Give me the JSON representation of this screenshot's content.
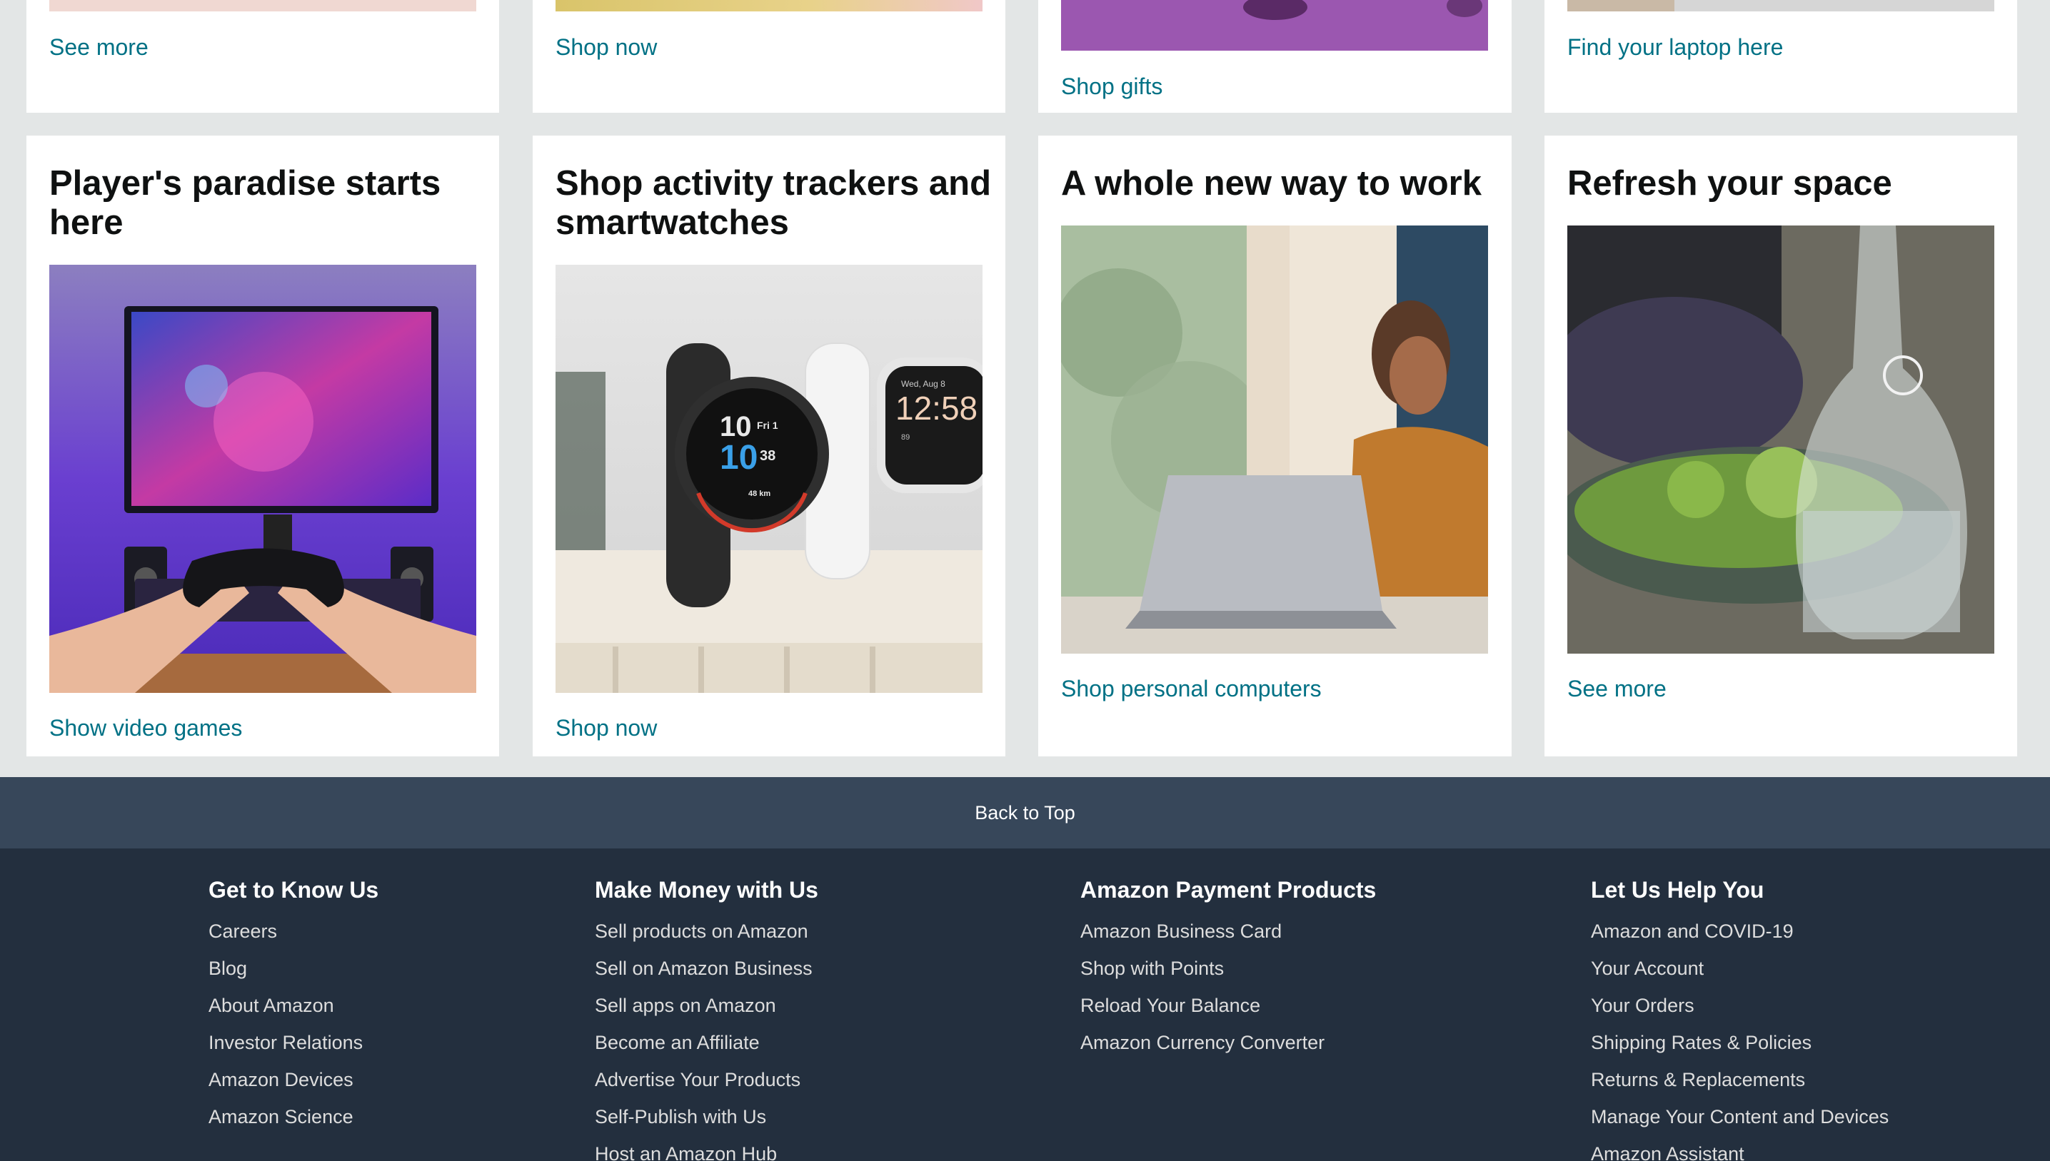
{
  "top_row": {
    "cards": [
      {
        "link": "See more"
      },
      {
        "link": "Shop now"
      },
      {
        "link": "Shop gifts"
      },
      {
        "link": "Find your laptop here"
      }
    ]
  },
  "bottom_row": {
    "cards": [
      {
        "title": "Player's paradise starts here",
        "link": "Show video games"
      },
      {
        "title": "Shop activity trackers and smartwatches",
        "link": "Shop now"
      },
      {
        "title": "A whole new way to work",
        "link": "Shop personal computers"
      },
      {
        "title": "Refresh your space",
        "link": "See more"
      }
    ]
  },
  "smartwatch_text": {
    "garmin_hour": "10",
    "garmin_day": "Fri 1",
    "garmin_minutes": "10",
    "garmin_seconds": "38",
    "garmin_distance": "48 km",
    "fitbit_date": "Wed, Aug 8",
    "fitbit_time": "12:58",
    "fitbit_stat": "89"
  },
  "back_to_top": "Back to Top",
  "footer": {
    "columns": [
      {
        "heading": "Get to Know Us",
        "links": [
          "Careers",
          "Blog",
          "About Amazon",
          "Investor Relations",
          "Amazon Devices",
          "Amazon Science"
        ]
      },
      {
        "heading": "Make Money with Us",
        "links": [
          "Sell products on Amazon",
          "Sell on Amazon Business",
          "Sell apps on Amazon",
          "Become an Affiliate",
          "Advertise Your Products",
          "Self-Publish with Us",
          "Host an Amazon Hub"
        ]
      },
      {
        "heading": "Amazon Payment Products",
        "links": [
          "Amazon Business Card",
          "Shop with Points",
          "Reload Your Balance",
          "Amazon Currency Converter"
        ]
      },
      {
        "heading": "Let Us Help You",
        "links": [
          "Amazon and COVID-19",
          "Your Account",
          "Your Orders",
          "Shipping Rates & Policies",
          "Returns & Replacements",
          "Manage Your Content and Devices",
          "Amazon Assistant"
        ]
      }
    ]
  },
  "colors": {
    "page_bg": "#e3e6e6",
    "link": "#007185",
    "back_to_top_bg": "#37475a",
    "footer_bg": "#232f3e"
  }
}
